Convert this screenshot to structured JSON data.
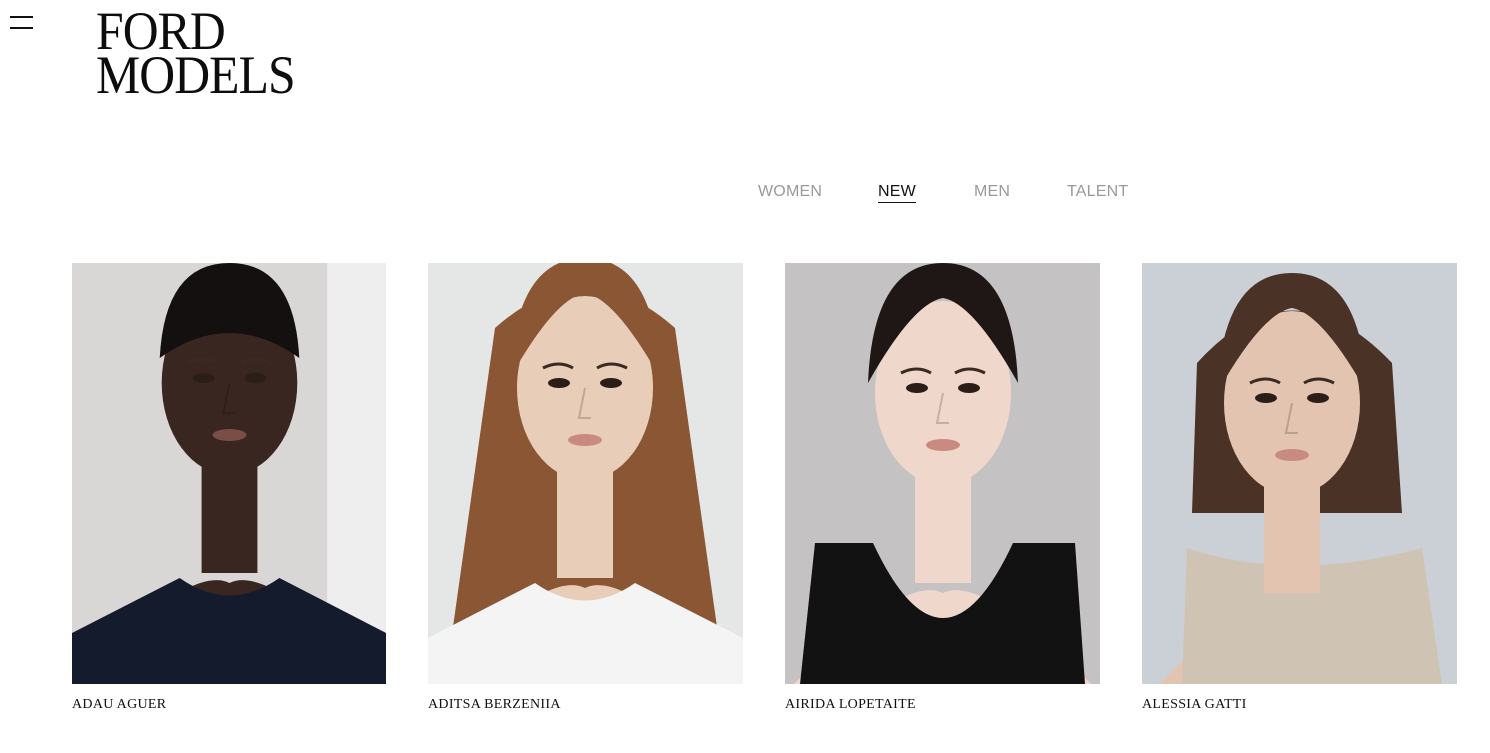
{
  "header": {
    "menu_icon": "hamburger-menu-icon",
    "logo_line1": "FORD",
    "logo_line2": "MODELS"
  },
  "nav": {
    "items": [
      {
        "label": "WOMEN",
        "active": false
      },
      {
        "label": "NEW",
        "active": true
      },
      {
        "label": "MEN",
        "active": false
      },
      {
        "label": "TALENT",
        "active": false
      }
    ]
  },
  "models": [
    {
      "name": "ADAU AGUER",
      "bg_color": "#d9d6d6",
      "skin": "#3a2620",
      "hair": "#141010",
      "top": "#141b2c"
    },
    {
      "name": "ADITSA BERZENIIA",
      "bg_color": "#e4e7e6",
      "skin": "#e8cdb9",
      "hair": "#8a5634",
      "top": "#f4f4f4"
    },
    {
      "name": "AIRIDA LOPETAITE",
      "bg_color": "#c4c2c3",
      "skin": "#efd7cc",
      "hair": "#1f1715",
      "top": "#121212"
    },
    {
      "name": "ALESSIA GATTI",
      "bg_color": "#cbd0d6",
      "skin": "#e3c4b0",
      "hair": "#4a3226",
      "top": "#cfc4b4"
    }
  ]
}
